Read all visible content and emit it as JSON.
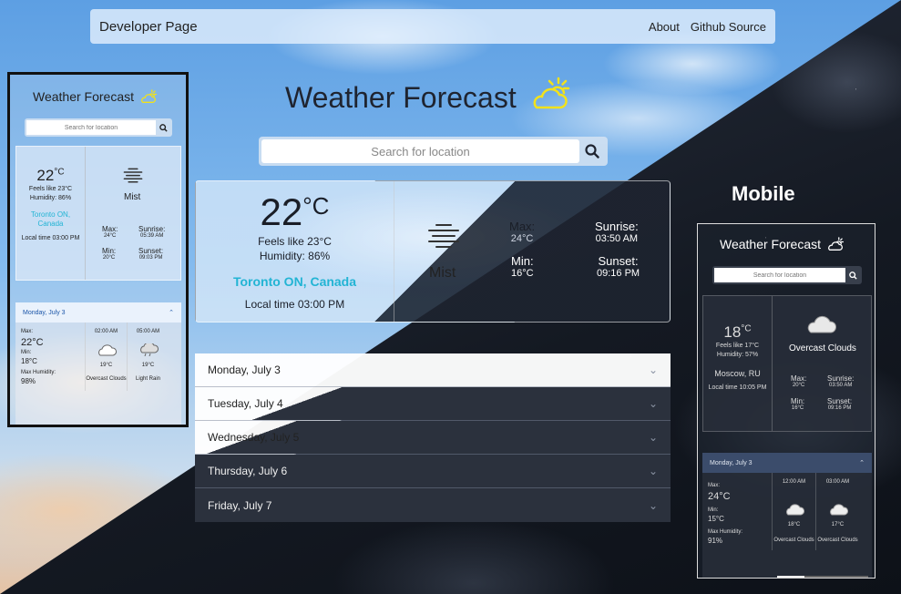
{
  "navbar": {
    "brand": "Developer Page",
    "links": [
      "About",
      "Github Source"
    ]
  },
  "app_title": "Weather Forecast",
  "search": {
    "placeholder": "Search for location"
  },
  "current": {
    "temp": "22",
    "unit": "°C",
    "feels_like": "Feels like 23°C",
    "humidity": "Humidity: 86%",
    "location": "Toronto ON, Canada",
    "local_time": "Local time 03:00 PM",
    "condition": "Mist",
    "max_label": "Max:",
    "max_value": "24°C",
    "min_label": "Min:",
    "min_value": "16°C",
    "sunrise_label": "Sunrise:",
    "sunrise_value": "03:50 AM",
    "sunset_label": "Sunset:",
    "sunset_value": "09:16 PM"
  },
  "forecast_days": [
    "Monday, July 3",
    "Tuesday, July 4",
    "Wednesday, July 5",
    "Thursday, July 6",
    "Friday, July 7"
  ],
  "mobile_label": "Mobile",
  "mobile_light": {
    "title": "Weather Forecast",
    "placeholder": "Search for location",
    "temp": "22",
    "unit": "°C",
    "feels_like": "Feels like 23°C",
    "humidity": "Humidity: 86%",
    "location_line1": "Toronto ON,",
    "location_line2": "Canada",
    "local_time": "Local time 03:00 PM",
    "condition": "Mist",
    "max_label": "Max:",
    "max_value": "24°C",
    "min_label": "Min:",
    "min_value": "20°C",
    "sunrise_label": "Sunrise:",
    "sunrise_value": "05:39 AM",
    "sunset_label": "Sunset:",
    "sunset_value": "09:03 PM",
    "day": "Monday, July 3",
    "summary": {
      "max_label": "Max:",
      "max": "22°C",
      "min_label": "Min:",
      "min": "18°C",
      "hum_label": "Max Humidity:",
      "hum": "98%"
    },
    "hours": [
      {
        "time": "02:00 AM",
        "temp": "19°C",
        "desc": "Overcast Clouds"
      },
      {
        "time": "05:00 AM",
        "temp": "19°C",
        "desc": "Light Rain"
      }
    ]
  },
  "mobile_dark": {
    "title": "Weather Forecast",
    "placeholder": "Search for location",
    "temp": "18",
    "unit": "°C",
    "feels_like": "Feels like 17°C",
    "humidity": "Humidity: 57%",
    "location": "Moscow, RU",
    "local_time": "Local time 10:05 PM",
    "condition": "Overcast Clouds",
    "max_label": "Max:",
    "max_value": "20°C",
    "min_label": "Min:",
    "min_value": "16°C",
    "sunrise_label": "Sunrise:",
    "sunrise_value": "03:50 AM",
    "sunset_label": "Sunset:",
    "sunset_value": "09:16 PM",
    "day": "Monday, July 3",
    "summary": {
      "max_label": "Max:",
      "max": "24°C",
      "min_label": "Min:",
      "min": "15°C",
      "hum_label": "Max Humidity:",
      "hum": "91%"
    },
    "hours": [
      {
        "time": "12:00 AM",
        "temp": "18°C",
        "desc": "Overcast Clouds"
      },
      {
        "time": "03:00 AM",
        "temp": "17°C",
        "desc": "Overcast Clouds"
      }
    ]
  },
  "colors": {
    "accent_location": "#22b4d4",
    "sun_icon": "#f2e21a"
  }
}
